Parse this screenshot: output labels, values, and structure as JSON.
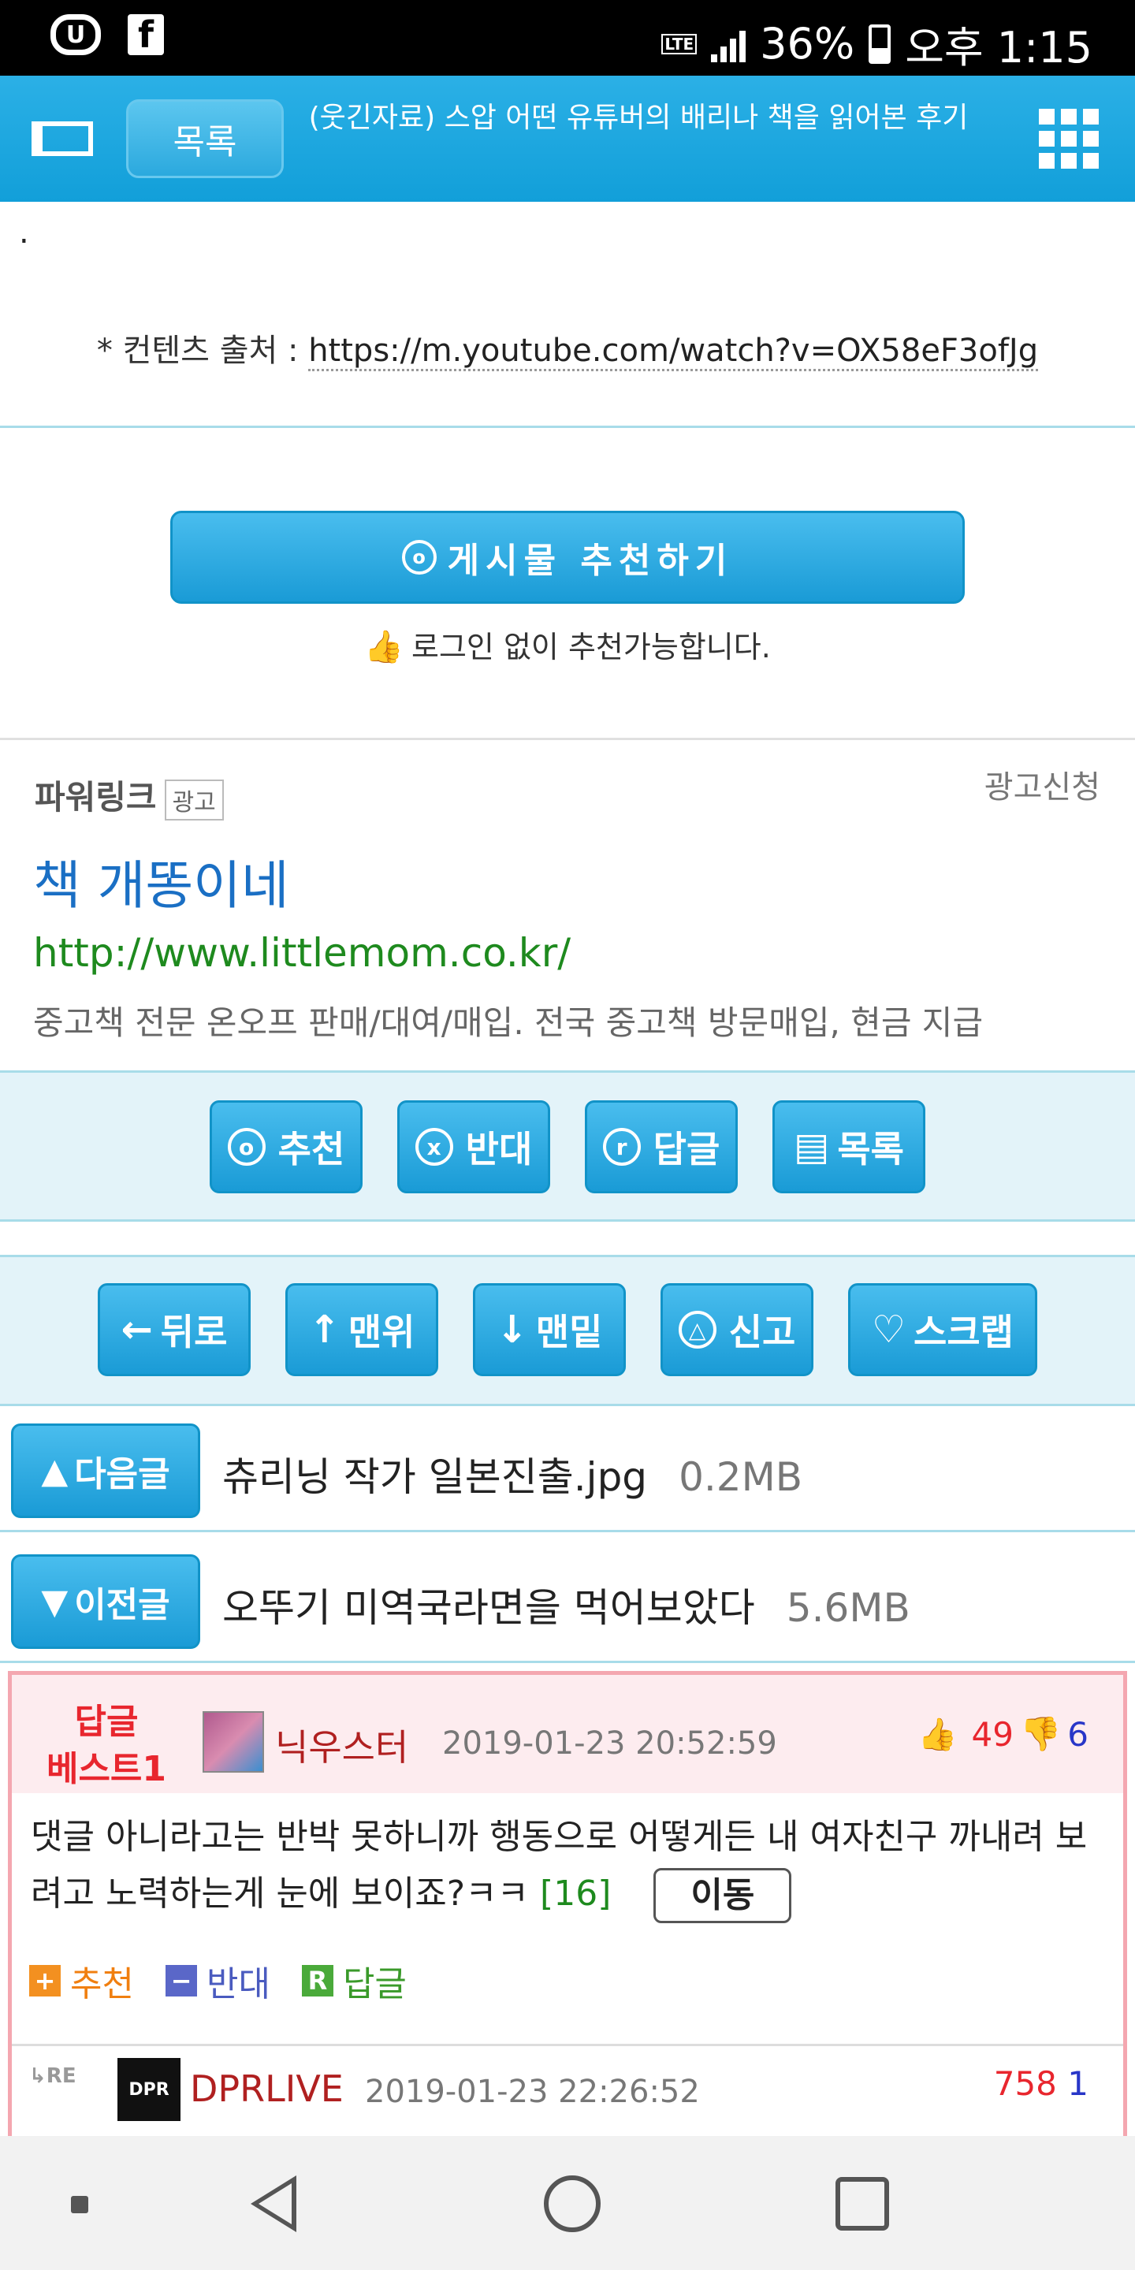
{
  "status_bar": {
    "carrier_icon": "U+ logo",
    "facebook_icon": "f",
    "lte_label": "LTE",
    "battery_percent": "36%",
    "time": "오후 1:15"
  },
  "header": {
    "list_button": "목록",
    "title": "(웃긴자료) 스압 어떤 유튜버의 배리나 책을 읽어본 후기"
  },
  "content": {
    "dot": ".",
    "source_prefix": "* 컨텐츠 출처 : ",
    "source_url": "https://m.youtube.com/watch?v=OX58eF3ofJg"
  },
  "recommend": {
    "icon_glyph": "o",
    "button_label": "게시물 추천하기",
    "note": "로그인 없이 추천가능합니다."
  },
  "ad": {
    "brand": "파워링크",
    "tag": "광고",
    "apply_label": "광고신청",
    "title": "책 개똥이네",
    "url": "http://www.littlemom.co.kr/",
    "description": "중고책 전문 온오프 판매/대여/매입. 전국 중고책 방문매입, 현금 지급"
  },
  "actions_row1": [
    {
      "icon": "o",
      "label": "추천"
    },
    {
      "icon": "x",
      "label": "반대"
    },
    {
      "icon": "r",
      "label": "답글"
    },
    {
      "icon": "list",
      "label": "목록"
    }
  ],
  "actions_row2": [
    {
      "icon": "←",
      "label": "뒤로"
    },
    {
      "icon": "↑",
      "label": "맨위"
    },
    {
      "icon": "↓",
      "label": "맨밑"
    },
    {
      "icon": "report",
      "label": "신고"
    },
    {
      "icon": "♡",
      "label": "스크랩"
    }
  ],
  "next_post": {
    "button_label": "다음글",
    "title": "츄리닝 작가 일본진출.jpg",
    "size": "0.2MB"
  },
  "prev_post": {
    "button_label": "이전글",
    "title": "오뚜기 미역국라면을 먹어보았다",
    "size": "5.6MB"
  },
  "best_comment": {
    "label_line1": "답글",
    "label_line2": "베스트1",
    "nickname": "닉우스터",
    "date": "2019-01-23 20:52:59",
    "upvotes": "49",
    "downvotes": "6",
    "body": "댓글 아니라고는 반박 못하니까 행동으로 어떻게든 내 여자친구 까내려 보려고 노력하는게 눈에 보이죠?ㅋㅋ",
    "reply_count": "[16]",
    "move_label": "이동",
    "action_recommend": "추천",
    "action_oppose": "반대",
    "action_reply": "답글"
  },
  "reply": {
    "re_mark": "RE",
    "avatar_text": "DPR",
    "nickname": "DPRLIVE",
    "date": "2019-01-23 22:26:52",
    "upvotes": "758",
    "downvotes": "1"
  },
  "colors": {
    "header_blue": "#1aa3dc",
    "button_blue": "#1a9bd6",
    "best_border": "#f4a7b0",
    "best_bg": "#fdecef",
    "ad_title": "#1a6fc4",
    "ad_url": "#1e8a1e"
  }
}
